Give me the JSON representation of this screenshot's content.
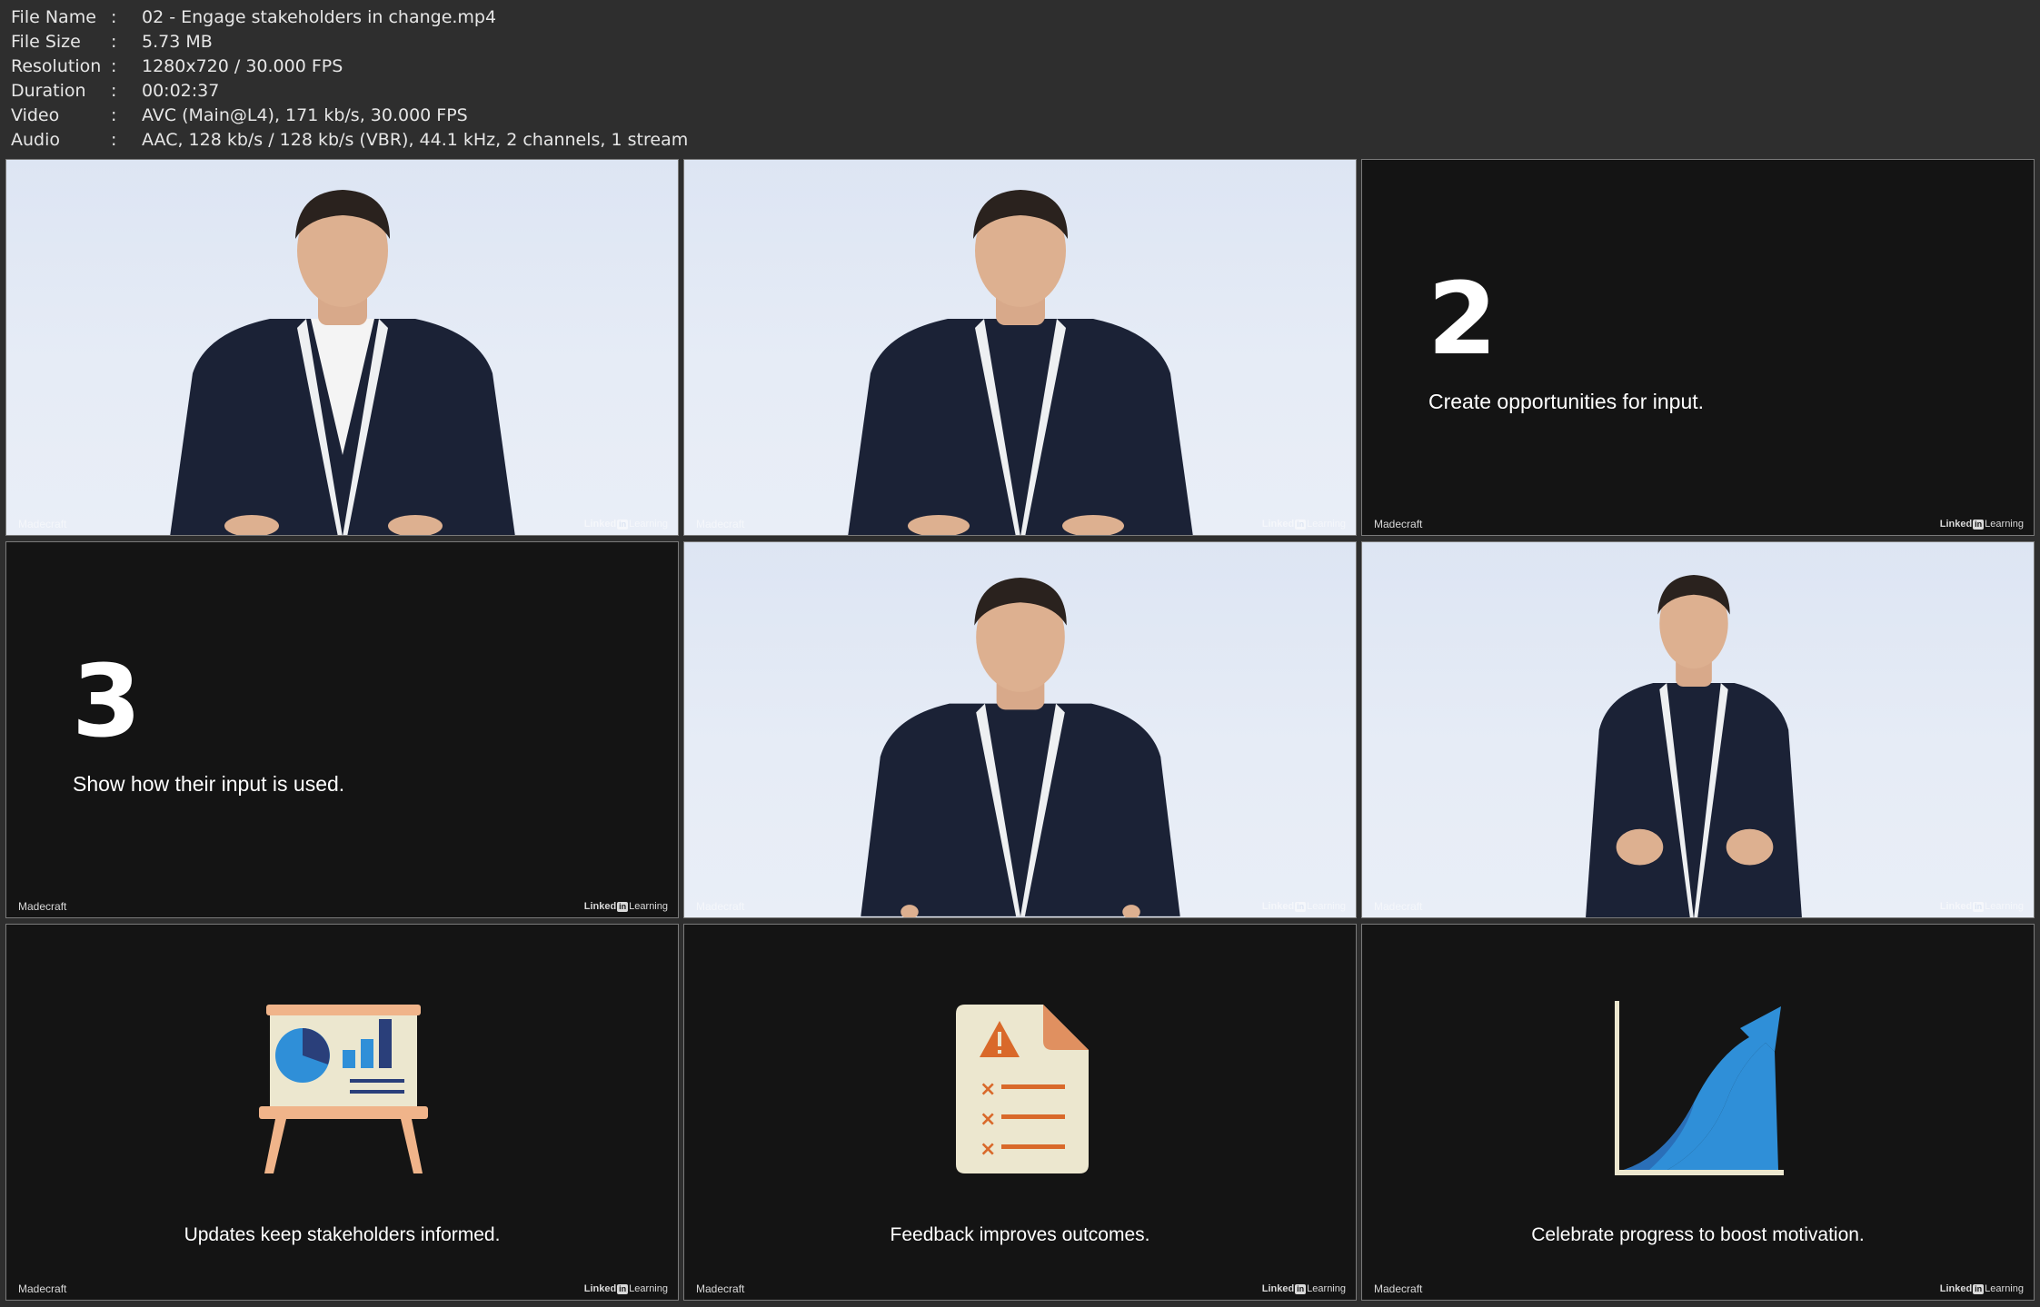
{
  "metadata": [
    {
      "key": "File Name",
      "value": "02 - Engage stakeholders in change.mp4"
    },
    {
      "key": "File Size",
      "value": "5.73 MB"
    },
    {
      "key": "Resolution",
      "value": "1280x720 / 30.000 FPS"
    },
    {
      "key": "Duration",
      "value": "00:02:37"
    },
    {
      "key": "Video",
      "value": "AVC (Main@L4), 171 kb/s, 30.000 FPS"
    },
    {
      "key": "Audio",
      "value": "AAC, 128 kb/s / 128 kb/s (VBR), 44.1 kHz, 2 channels, 1 stream"
    }
  ],
  "separator": ":",
  "branding": {
    "left": "Madecraft",
    "right_word": "Linked",
    "right_in": "in",
    "right_suffix": "Learning"
  },
  "thumbnails": [
    {
      "kind": "presenter"
    },
    {
      "kind": "presenter"
    },
    {
      "kind": "slide",
      "number": "2",
      "text": "Create opportunities for input."
    },
    {
      "kind": "slide",
      "number": "3",
      "text": "Show how their input is used."
    },
    {
      "kind": "presenter"
    },
    {
      "kind": "presenter"
    },
    {
      "kind": "icon",
      "icon": "presentation-board-icon",
      "caption": "Updates keep stakeholders informed."
    },
    {
      "kind": "icon",
      "icon": "feedback-document-icon",
      "caption": "Feedback improves outcomes."
    },
    {
      "kind": "icon",
      "icon": "growth-chart-icon",
      "caption": "Celebrate progress to boost motivation."
    }
  ],
  "colors": {
    "background": "#2e2e2e",
    "slide": "#141414",
    "studio": "#e3e9f5",
    "suit": "#1b2236",
    "accent_blue": "#2f8fd8",
    "accent_orange": "#d9692a"
  }
}
